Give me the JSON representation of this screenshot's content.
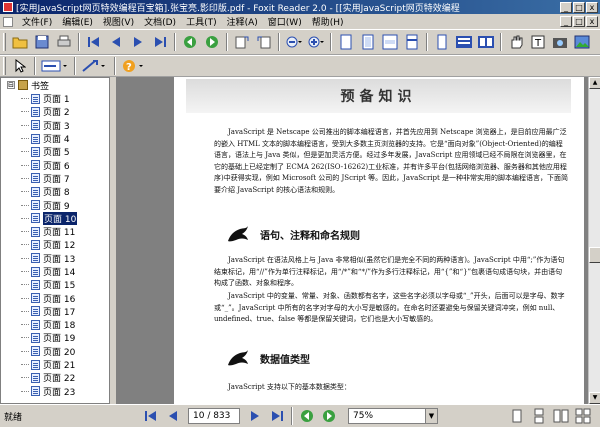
{
  "window": {
    "title": "[实用JavaScript网页特效编程百宝箱].张宝亮.影印版.pdf - Foxit Reader 2.0 - [[实用JavaScript网页特效编程",
    "min_label": "_",
    "max_label": "□",
    "close_label": "x"
  },
  "menubar": {
    "items": [
      "文件(F)",
      "编辑(E)",
      "视图(V)",
      "文档(D)",
      "工具(T)",
      "注释(A)",
      "窗口(W)",
      "帮助(H)"
    ],
    "mdi_min": "_",
    "mdi_restore": "□",
    "mdi_close": "x"
  },
  "sidebar": {
    "root_label": "书签",
    "expander": "⊟",
    "items": [
      "页面 1",
      "页面 2",
      "页面 3",
      "页面 4",
      "页面 5",
      "页面 6",
      "页面 7",
      "页面 8",
      "页面 9",
      "页面 10",
      "页面 11",
      "页面 12",
      "页面 13",
      "页面 14",
      "页面 15",
      "页面 16",
      "页面 17",
      "页面 18",
      "页面 19",
      "页面 20",
      "页面 21",
      "页面 22",
      "页面 23"
    ],
    "selected_index": 9
  },
  "document": {
    "header": "预备知识",
    "para1": "JavaScript 是 Netscape 公司推出的脚本编程语言，并首先应用到 Netscape 浏览器上，是目前应用最广泛的嵌入 HTML 文本的脚本编程语言，受到大多数主页浏览器的支持。它是“面向对象”(Object-Oriented)的编程语言，语法上与 Java 类似，但是更加灵活方便。经过多年发展，JavaScript 应用领域已经不局限在浏览器里，在它的基础上已经定制了 ECMA 262(ISO-16262)工业标准，并有许多平台(包括网络浏览器、服务器和其他应用程序)中获得实现，例如 Microsoft 公司的 JScript 等。因此，JavaScript 是一种非常实用的脚本编程语言，下面简要介绍 JavaScript 的核心语法和规则。",
    "section1": "语句、注释和命名规则",
    "para2": "JavaScript 在语法风格上与 Java 非常相似(虽然它们是完全不同的两种语言)。JavaScript 中用“;”作为语句结束标记，用“//”作为单行注释标记，用“/*”和“*/”作为多行注释标记，用“{”和“}”包裹语句成语句块，并由语句构成了函数、对象和程序。",
    "para3": "JavaScript 中的变量、常量、对象、函数都有名字，这些名字必须以字母或“_”开头，后面可以是字母、数字或“_”。JavaScript 中所有的名字对字母的大小写是敏感的。在命名时还要避免与保留关键词冲突，例如 null、undefined、true、false 等都是保留关键词，它们也是大小写敏感的。",
    "section2": "数据值类型",
    "para4": "JavaScript 支持以下的基本数据类型："
  },
  "status": {
    "text": "就绪",
    "page_box": "10 / 833",
    "zoom": "75%",
    "dropdown": "▼"
  },
  "colors": {
    "selection": "#0a246a",
    "titlebar": "#0a246a"
  }
}
